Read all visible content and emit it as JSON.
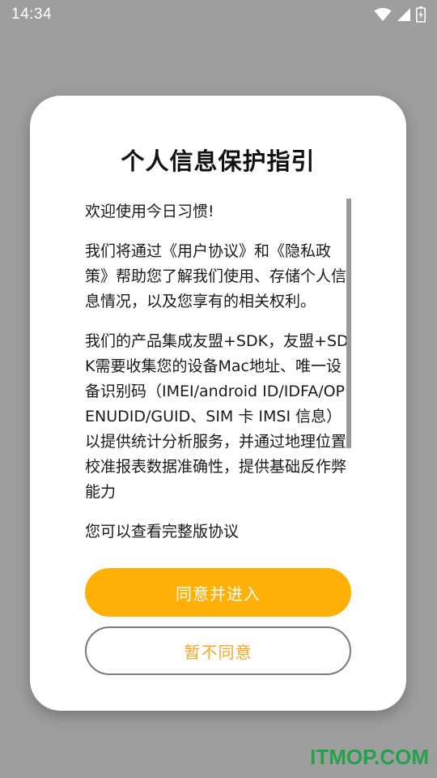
{
  "status_bar": {
    "time": "14:34",
    "icons": [
      "wifi-icon",
      "cellular-signal-icon",
      "battery-charging-icon"
    ]
  },
  "dialog": {
    "title": "个人信息保护指引",
    "paragraphs": [
      "欢迎使用今日习惯!",
      "我们将通过《用户协议》和《隐私政策》帮助您了解我们使用、存储个人信息情况，以及您享有的相关权利。",
      "我们的产品集成友盟+SDK，友盟+SDK需要收集您的设备Mac地址、唯一设备识别码（IMEI/android ID/IDFA/OPENUDID/GUID、SIM 卡 IMSI 信息）以提供统计分析服务，并通过地理位置校准报表数据准确性，提供基础反作弊能力",
      "您可以查看完整版协议"
    ],
    "agree_label": "同意并进入",
    "disagree_label": "暂不同意"
  },
  "watermark": "ITMOP.COM",
  "colors": {
    "accent": "#ffb006",
    "disagree_text": "#f5a623",
    "backdrop": "#9e9e9e",
    "watermark": "#22a34a"
  }
}
